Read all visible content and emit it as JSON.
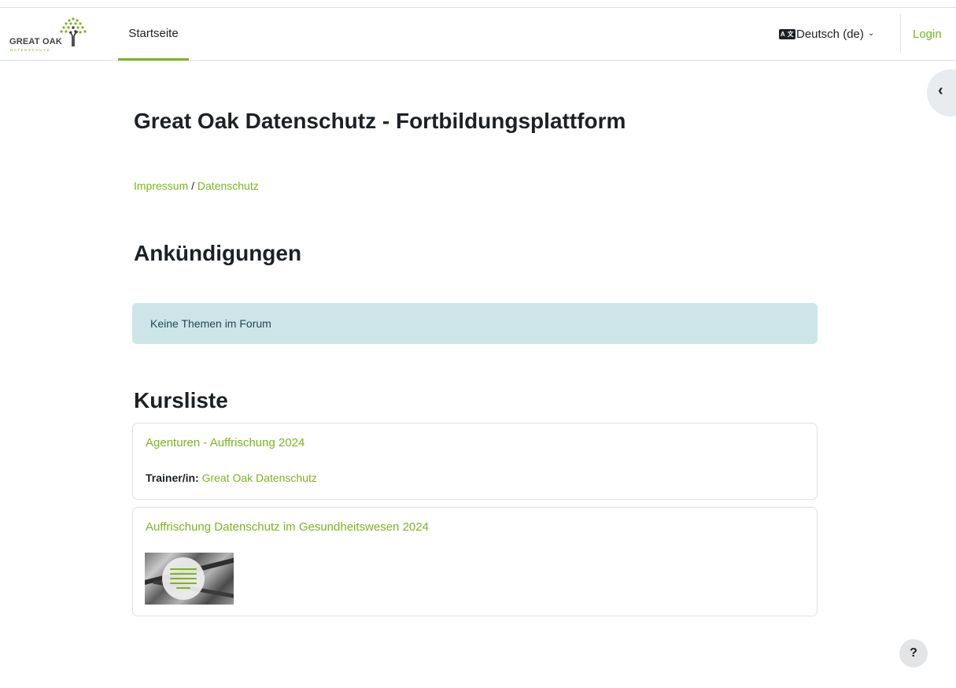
{
  "header": {
    "logo_text": "GREAT OAK",
    "logo_sub": "DATENSCHUTZ",
    "nav_home": "Startseite",
    "lang_icon_text": "A 文",
    "language": "Deutsch (de)",
    "login": "Login"
  },
  "main": {
    "title": "Great Oak Datenschutz - Fortbildungsplattform",
    "links": {
      "impressum": "Impressum",
      "separator": " / ",
      "datenschutz": "Datenschutz"
    },
    "announcements_heading": "Ankündigungen",
    "announcements_empty": "Keine Themen im Forum",
    "courses_heading": "Kursliste",
    "courses": [
      {
        "title": "Agenturen - Auffrischung 2024",
        "trainer_label": "Trainer/in:",
        "trainer_name": "Great Oak Datenschutz"
      },
      {
        "title": "Auffrischung Datenschutz im Gesundheitswesen 2024"
      }
    ]
  },
  "help_label": "?",
  "colors": {
    "accent": "#7ab51d",
    "text": "#1d2125",
    "alert_bg": "#cde5e9",
    "border": "#dee2e6"
  },
  "icons": [
    "logo-tree-icon",
    "language-icon",
    "chevron-down-icon",
    "chevron-left-icon",
    "help-icon"
  ]
}
